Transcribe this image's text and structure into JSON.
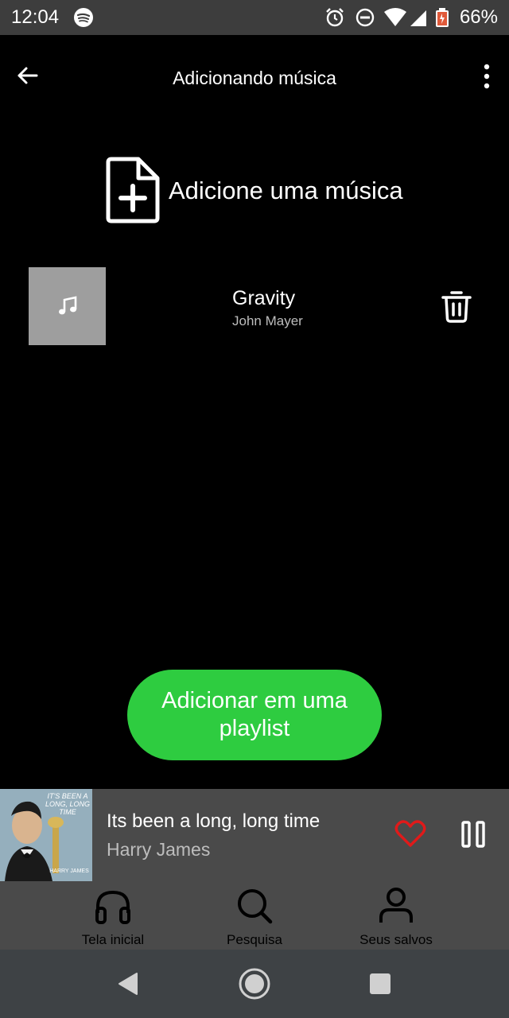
{
  "status_bar": {
    "time": "12:04",
    "battery": "66%",
    "icons": [
      "spotify-icon",
      "alarm-icon",
      "dnd-icon",
      "wifi-icon",
      "signal-icon",
      "battery-icon"
    ]
  },
  "app_bar": {
    "title": "Adicionando música",
    "back_icon": "arrow-left-icon",
    "menu_icon": "more-vertical-icon"
  },
  "add_song": {
    "label": "Adicione uma música",
    "icon": "file-plus-icon"
  },
  "tracks": [
    {
      "title": "Gravity",
      "artist": "John Mayer",
      "thumb_icon": "music-note-icon",
      "action_icon": "trash-icon"
    }
  ],
  "cta": {
    "label": "Adicionar em uma playlist"
  },
  "now_playing": {
    "title": "Its been a long, long time",
    "artist": "Harry James",
    "cover_text": "IT'S BEEN A LONG, LONG TIME",
    "cover_footer": "HARRY JAMES",
    "heart_icon": "heart-outline-icon",
    "pause_icon": "pause-icon"
  },
  "bottom_nav": {
    "items": [
      {
        "label": "Tela inicial",
        "icon": "headphones-icon"
      },
      {
        "label": "Pesquisa",
        "icon": "search-icon"
      },
      {
        "label": "Seus salvos",
        "icon": "user-icon"
      }
    ]
  },
  "colors": {
    "accent_green": "#2ECC40",
    "heart_red": "#E01A1A",
    "background": "#000000",
    "bar_gray": "#4A4A4A"
  }
}
